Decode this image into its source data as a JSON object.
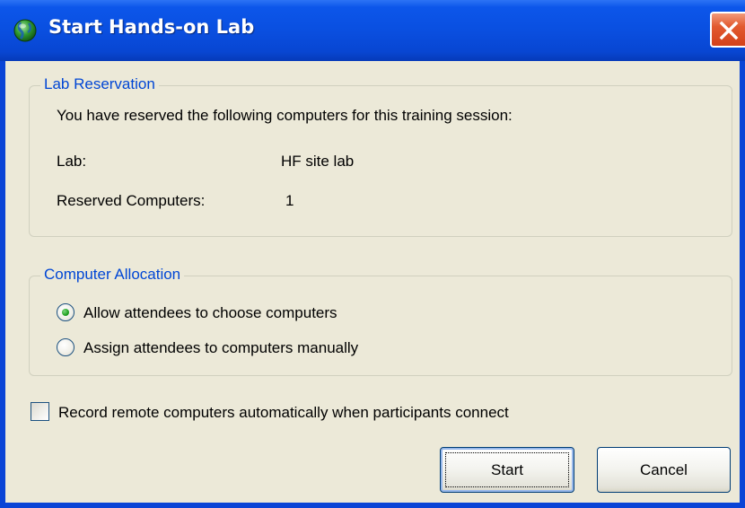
{
  "window": {
    "title": "Start Hands-on Lab",
    "icons": {
      "app": "globe-icon",
      "close": "close-x-icon"
    }
  },
  "lab_reservation": {
    "legend": "Lab Reservation",
    "intro": "You have reserved the following computers for this training session:",
    "lab_label": "Lab:",
    "lab_value": "HF site lab",
    "reserved_label": "Reserved Computers:",
    "reserved_value": "1"
  },
  "computer_allocation": {
    "legend": "Computer Allocation",
    "options": [
      {
        "label": "Allow attendees to choose computers",
        "selected": true
      },
      {
        "label": "Assign attendees to computers manually",
        "selected": false
      }
    ]
  },
  "record_option": {
    "label": "Record remote computers automatically when participants connect",
    "checked": false
  },
  "buttons": {
    "start": "Start",
    "cancel": "Cancel"
  },
  "colors": {
    "titlebar": "#0a4fe0",
    "group_legend": "#0046d5",
    "dialog_bg": "#ece9d8",
    "close_button": "#e25a2f"
  }
}
